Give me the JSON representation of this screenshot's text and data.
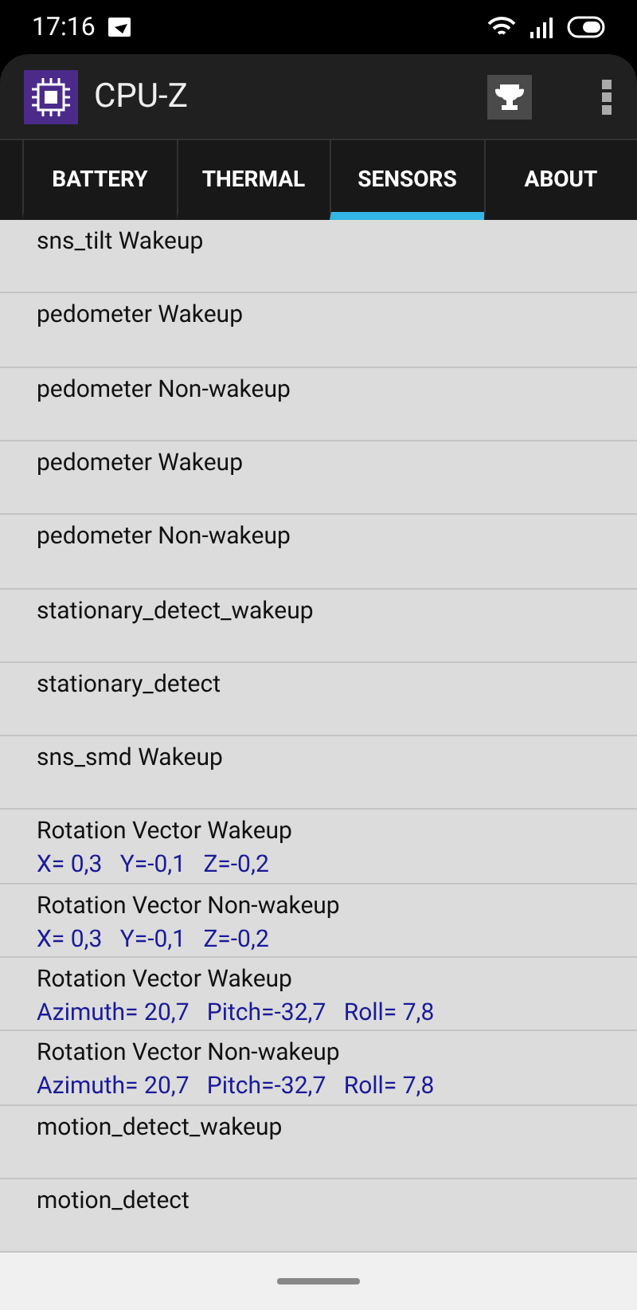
{
  "status_bar": {
    "time": "17:16"
  },
  "app_bar": {
    "title": "CPU-Z"
  },
  "tabs": [
    {
      "label": "BATTERY",
      "selected": false
    },
    {
      "label": "THERMAL",
      "selected": false
    },
    {
      "label": "SENSORS",
      "selected": true
    },
    {
      "label": "ABOUT",
      "selected": false
    }
  ],
  "sensors": [
    {
      "name": "sns_tilt  Wakeup"
    },
    {
      "name": "pedometer  Wakeup"
    },
    {
      "name": "pedometer  Non-wakeup"
    },
    {
      "name": "pedometer  Wakeup"
    },
    {
      "name": "pedometer  Non-wakeup"
    },
    {
      "name": "stationary_detect_wakeup"
    },
    {
      "name": "stationary_detect"
    },
    {
      "name": "sns_smd  Wakeup"
    },
    {
      "name": "Rotation Vector  Wakeup",
      "value": "X= 0,3   Y=-0,1   Z=-0,2"
    },
    {
      "name": "Rotation Vector  Non-wakeup",
      "value": "X= 0,3   Y=-0,1   Z=-0,2"
    },
    {
      "name": "Rotation Vector  Wakeup",
      "value": "Azimuth= 20,7   Pitch=-32,7   Roll= 7,8"
    },
    {
      "name": "Rotation Vector  Non-wakeup",
      "value": "Azimuth= 20,7   Pitch=-32,7   Roll= 7,8"
    },
    {
      "name": "motion_detect_wakeup"
    },
    {
      "name": "motion_detect"
    }
  ]
}
